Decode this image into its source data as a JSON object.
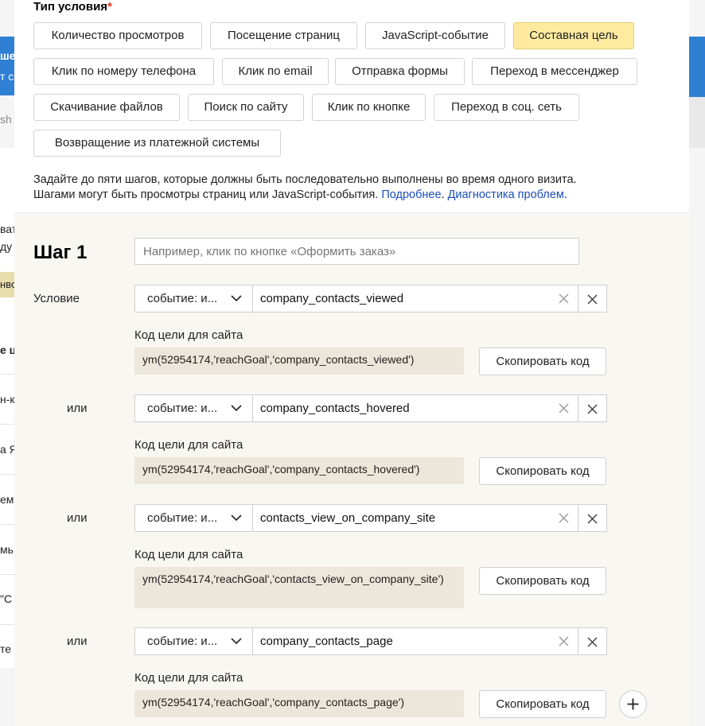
{
  "background": {
    "left_fragments": [
      "ше",
      "т с",
      "sh",
      "ват",
      "ду",
      "нво",
      "е ц",
      "н-к",
      "а Я",
      "ем",
      "мь",
      "\"С",
      "те"
    ]
  },
  "condition_type": {
    "title": "Тип условия",
    "required_mark": "*",
    "options": [
      {
        "label": "Количество просмотров",
        "active": false
      },
      {
        "label": "Посещение страниц",
        "active": false
      },
      {
        "label": "JavaScript-событие",
        "active": false
      },
      {
        "label": "Составная цель",
        "active": true
      },
      {
        "label": "Клик по номеру телефона",
        "active": false
      },
      {
        "label": "Клик по email",
        "active": false
      },
      {
        "label": "Отправка формы",
        "active": false
      },
      {
        "label": "Переход в мессенджер",
        "active": false
      },
      {
        "label": "Скачивание файлов",
        "active": false
      },
      {
        "label": "Поиск по сайту",
        "active": false
      },
      {
        "label": "Клик по кнопке",
        "active": false
      },
      {
        "label": "Переход в соц. сеть",
        "active": false
      },
      {
        "label": "Возвращение из платежной системы",
        "active": false
      }
    ]
  },
  "description": {
    "line1": "Задайте до пяти шагов, которые должны быть последовательно выполнены во время одного визита.",
    "line2": "Шагами могут быть просмотры страниц или JavaScript-события. ",
    "link_more": "Подробнее",
    "dot": ". ",
    "link_diag": "Диагностика проблем",
    "dot_end": "."
  },
  "step": {
    "title": "Шаг 1",
    "name_placeholder": "Например, клик по кнопке «Оформить заказ»",
    "goal_code_label": "Код цели для сайта",
    "copy_label": "Скопировать код",
    "conditions": [
      {
        "label": "Условие",
        "select": "событие: и...",
        "value": "company_contacts_viewed",
        "code": "ym(52954174,'reachGoal','company_contacts_viewed')"
      },
      {
        "label": "или",
        "select": "событие: и...",
        "value": "company_contacts_hovered",
        "code": "ym(52954174,'reachGoal','company_contacts_hovered')"
      },
      {
        "label": "или",
        "select": "событие: и...",
        "value": "contacts_view_on_company_site",
        "code": "ym(52954174,'reachGoal','contacts_view_on_company_site')"
      },
      {
        "label": "или",
        "select": "событие: и...",
        "value": "company_contacts_page",
        "code": "ym(52954174,'reachGoal','company_contacts_page')"
      }
    ]
  }
}
